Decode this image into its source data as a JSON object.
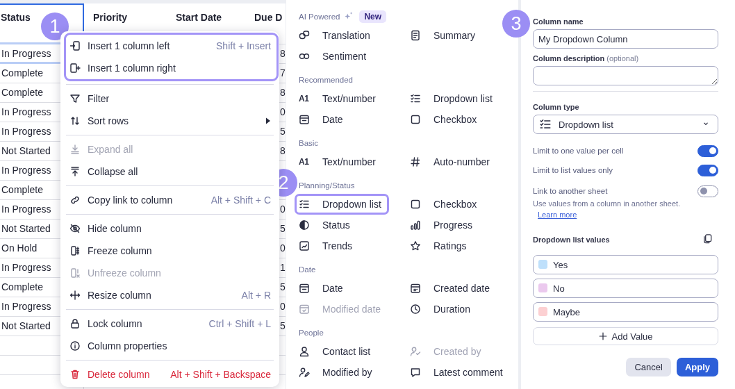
{
  "table": {
    "columns": [
      {
        "label": "Status",
        "selected": true
      },
      {
        "label": "Priority",
        "selected": false
      },
      {
        "label": "Start Date",
        "selected": false
      },
      {
        "label": "Due D",
        "selected": false
      }
    ],
    "rows": [
      {
        "status": "In Progress",
        "due": "8",
        "selected": true
      },
      {
        "status": "Complete",
        "due": "7",
        "selected": false
      },
      {
        "status": "Complete",
        "due": "8",
        "selected": false
      },
      {
        "status": "In Progress",
        "due": "0",
        "selected": false
      },
      {
        "status": "In Progress",
        "due": "5",
        "selected": false
      },
      {
        "status": "Not Started",
        "due": "8",
        "selected": false
      },
      {
        "status": "In Progress",
        "selected": false
      },
      {
        "status": "Complete",
        "selected": false
      },
      {
        "status": "In Progress",
        "due": "0",
        "selected": false
      },
      {
        "status": "Not Started",
        "due": "5",
        "selected": false
      },
      {
        "status": "On Hold",
        "due": "0",
        "selected": false
      },
      {
        "status": "In Progress",
        "due": "1",
        "selected": false
      },
      {
        "status": "Complete",
        "due": "5",
        "selected": false
      },
      {
        "status": "In Progress",
        "due": "0",
        "selected": false
      },
      {
        "status": "Not Started",
        "due": "5",
        "selected": false
      }
    ]
  },
  "context_menu": {
    "badge": "1",
    "groups": [
      {
        "highlighted": true,
        "items": [
          {
            "label": "Insert 1 column left",
            "shortcut": "Shift + Insert",
            "kind": "action",
            "disabled": false
          },
          {
            "label": "Insert 1 column right",
            "kind": "action",
            "disabled": false
          }
        ]
      },
      {
        "highlighted": false,
        "items": [
          {
            "label": "Filter",
            "kind": "action",
            "disabled": false
          },
          {
            "label": "Sort rows",
            "kind": "submenu",
            "disabled": false
          }
        ]
      },
      {
        "highlighted": false,
        "items": [
          {
            "label": "Expand all",
            "kind": "action",
            "disabled": true
          },
          {
            "label": "Collapse all",
            "kind": "action",
            "disabled": false
          }
        ]
      },
      {
        "highlighted": false,
        "items": [
          {
            "label": "Copy link to column",
            "shortcut": "Alt + Shift + C",
            "kind": "action",
            "disabled": false
          }
        ]
      },
      {
        "highlighted": false,
        "items": [
          {
            "label": "Hide column",
            "kind": "action",
            "disabled": false
          },
          {
            "label": "Freeze column",
            "kind": "action",
            "disabled": false
          },
          {
            "label": "Unfreeze column",
            "kind": "action",
            "disabled": true
          },
          {
            "label": "Resize column",
            "shortcut": "Alt + R",
            "kind": "action",
            "disabled": false
          }
        ]
      },
      {
        "highlighted": false,
        "items": [
          {
            "label": "Lock column",
            "shortcut": "Ctrl + Shift + L",
            "kind": "action",
            "disabled": false
          },
          {
            "label": "Column properties",
            "kind": "action",
            "disabled": false
          }
        ]
      },
      {
        "highlighted": false,
        "items": [
          {
            "label": "Delete column",
            "shortcut": "Alt + Shift + Backspace",
            "kind": "danger",
            "disabled": false
          }
        ]
      }
    ]
  },
  "column_types": {
    "badge": "2",
    "sections": [
      {
        "title": "AI Powered",
        "tag": "New",
        "items": [
          {
            "label": "Translation",
            "selected": false,
            "disabled": false
          },
          {
            "label": "Summary",
            "selected": false,
            "disabled": false
          },
          {
            "label": "Sentiment",
            "selected": false,
            "disabled": false
          }
        ]
      },
      {
        "title": "Recommended",
        "items": [
          {
            "label": "Text/number",
            "glyph": "A1",
            "selected": false,
            "disabled": false
          },
          {
            "label": "Dropdown list",
            "selected": false,
            "disabled": false
          },
          {
            "label": "Date",
            "selected": false,
            "disabled": false
          },
          {
            "label": "Checkbox",
            "selected": false,
            "disabled": false
          }
        ]
      },
      {
        "title": "Basic",
        "items": [
          {
            "label": "Text/number",
            "glyph": "A1",
            "selected": false,
            "disabled": false
          },
          {
            "label": "Auto-number",
            "selected": false,
            "disabled": false
          }
        ]
      },
      {
        "title": "Planning/Status",
        "items": [
          {
            "label": "Dropdown list",
            "selected": true,
            "disabled": false
          },
          {
            "label": "Checkbox",
            "selected": false,
            "disabled": false
          },
          {
            "label": "Status",
            "selected": false,
            "disabled": false
          },
          {
            "label": "Progress",
            "selected": false,
            "disabled": false
          },
          {
            "label": "Trends",
            "selected": false,
            "disabled": false
          },
          {
            "label": "Ratings",
            "selected": false,
            "disabled": false
          }
        ]
      },
      {
        "title": "Date",
        "items": [
          {
            "label": "Date",
            "selected": false,
            "disabled": false
          },
          {
            "label": "Created date",
            "selected": false,
            "disabled": false
          },
          {
            "label": "Modified date",
            "selected": false,
            "disabled": true
          },
          {
            "label": "Duration",
            "selected": false,
            "disabled": false
          }
        ]
      },
      {
        "title": "People",
        "items": [
          {
            "label": "Contact list",
            "selected": false,
            "disabled": false
          },
          {
            "label": "Created by",
            "selected": false,
            "disabled": true
          },
          {
            "label": "Modified by",
            "selected": false,
            "disabled": false
          },
          {
            "label": "Latest comment",
            "selected": false,
            "disabled": false
          }
        ]
      }
    ]
  },
  "column_settings": {
    "badge": "3",
    "name_label": "Column name",
    "name_value": "My Dropdown Column",
    "description_label": "**Column description** (optional)",
    "type_label": "Column type",
    "type_value": "Dropdown list",
    "toggles": [
      {
        "label": "Limit to one value per cell",
        "on": true
      },
      {
        "label": "Limit to list values only",
        "on": true
      },
      {
        "label": "Link to another sheet",
        "on": false,
        "hint": "Use values from a column in another sheet.",
        "link": "Learn more"
      }
    ],
    "values_label": "Dropdown list values",
    "values": [
      {
        "label": "Yes",
        "color": "#bfe0fb"
      },
      {
        "label": "No",
        "color": "#ebc9ee"
      },
      {
        "label": "Maybe",
        "color": "#fcd0d2"
      }
    ],
    "add_label": "Add Value",
    "buttons": [
      {
        "label": "Cancel",
        "kind": "secondary"
      },
      {
        "label": "Apply",
        "kind": "primary"
      }
    ]
  }
}
